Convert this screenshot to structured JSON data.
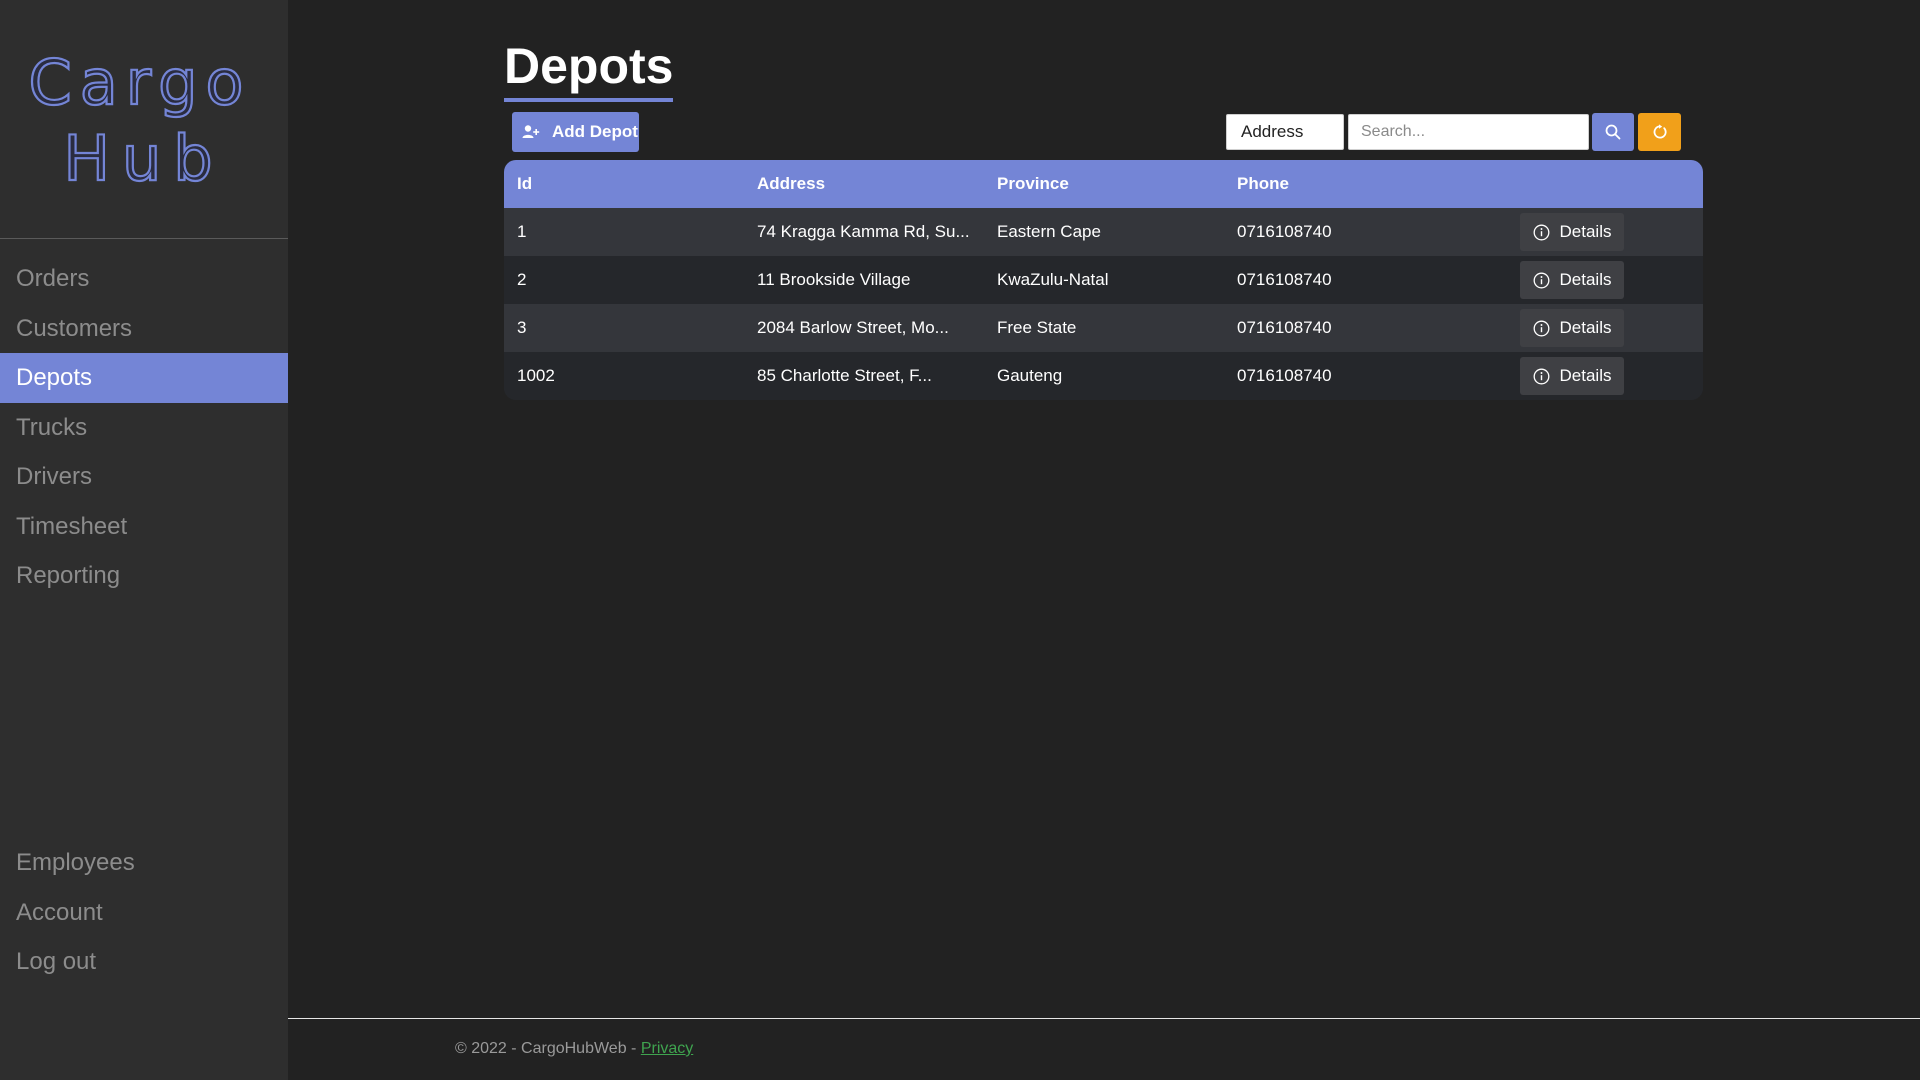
{
  "sidebar": {
    "logo_line1": "Cargo",
    "logo_line2": "Hub",
    "nav_main": [
      "Orders",
      "Customers",
      "Depots",
      "Trucks",
      "Drivers",
      "Timesheet",
      "Reporting"
    ],
    "nav_bottom": [
      "Employees",
      "Account",
      "Log out"
    ],
    "active": "Depots"
  },
  "page": {
    "title": "Depots",
    "add_button": "Add Depot",
    "filter_field": "Address",
    "search_placeholder": "Search..."
  },
  "table": {
    "headers": [
      "Id",
      "Address",
      "Province",
      "Phone"
    ],
    "rows": [
      {
        "id": "1",
        "address": "74 Kragga Kamma Rd, Su...",
        "province": "Eastern Cape",
        "phone": "0716108740",
        "action": "Details"
      },
      {
        "id": "2",
        "address": "11 Brookside Village",
        "province": "KwaZulu-Natal",
        "phone": "0716108740",
        "action": "Details"
      },
      {
        "id": "3",
        "address": "2084 Barlow Street, Mo...",
        "province": "Free State",
        "phone": "0716108740",
        "action": "Details"
      },
      {
        "id": "1002",
        "address": "85 Charlotte Street, F...",
        "province": "Gauteng",
        "phone": "0716108740",
        "action": "Details"
      }
    ]
  },
  "footer": {
    "text": "© 2022 - CargoHubWeb - ",
    "link": "Privacy"
  },
  "colors": {
    "accent": "#7485d6",
    "refresh": "#f1a01a",
    "background": "#222222",
    "sidebar": "#2e2e2e"
  },
  "icons": {
    "add": "user-plus-icon",
    "search": "search-icon",
    "refresh": "refresh-icon",
    "details": "info-circle-icon"
  }
}
